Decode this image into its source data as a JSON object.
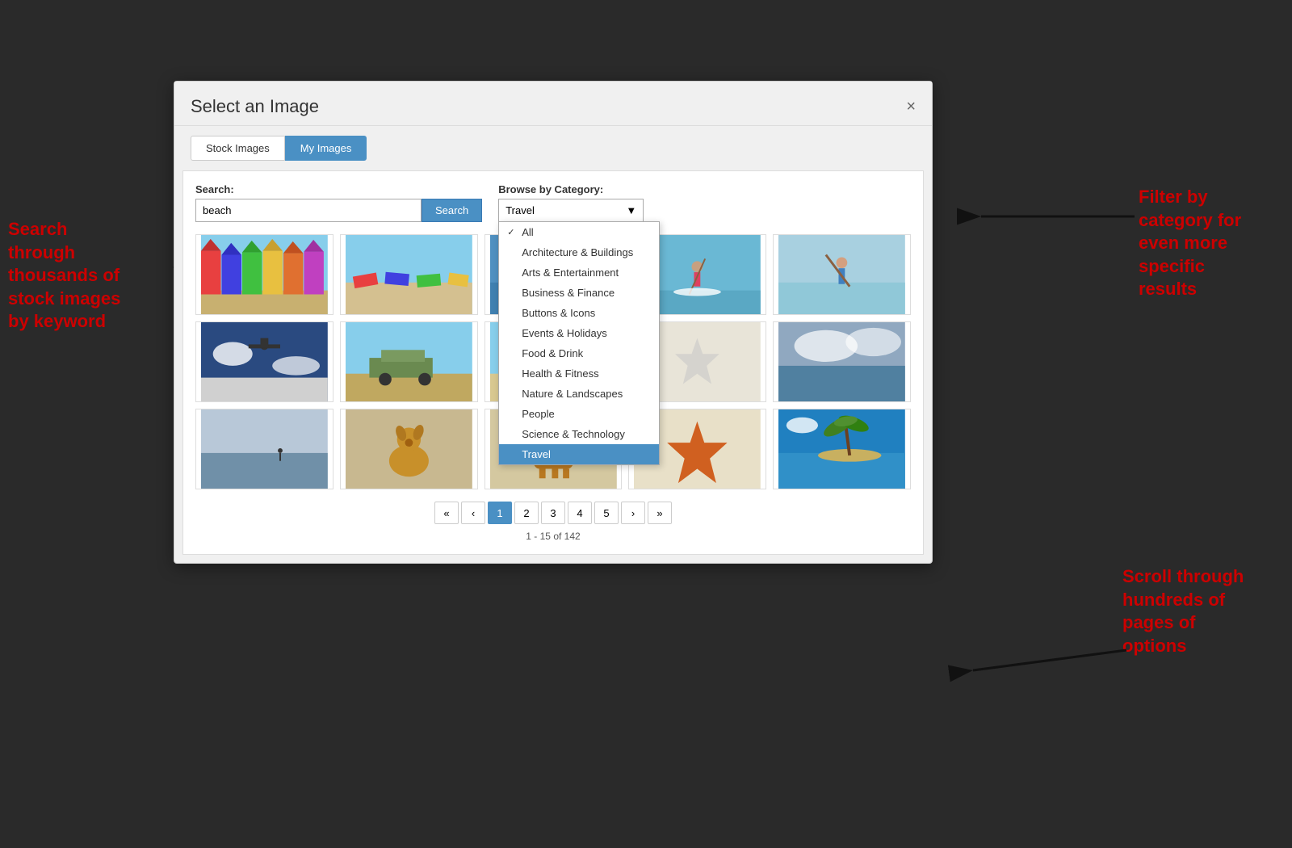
{
  "dialog": {
    "title": "Select an Image",
    "close_label": "×",
    "tabs": [
      {
        "id": "stock",
        "label": "Stock Images",
        "active": false
      },
      {
        "id": "my",
        "label": "My Images",
        "active": true
      }
    ],
    "search": {
      "label": "Search:",
      "placeholder": "beach",
      "value": "beach",
      "button_label": "Search"
    },
    "category": {
      "label": "Browse by Category:",
      "selected": "Travel",
      "options": [
        {
          "value": "all",
          "label": "All",
          "checked": true
        },
        {
          "value": "arch",
          "label": "Architecture & Buildings"
        },
        {
          "value": "arts",
          "label": "Arts & Entertainment"
        },
        {
          "value": "biz",
          "label": "Business & Finance"
        },
        {
          "value": "icons",
          "label": "Buttons & Icons"
        },
        {
          "value": "events",
          "label": "Events & Holidays"
        },
        {
          "value": "food",
          "label": "Food & Drink"
        },
        {
          "value": "health",
          "label": "Health & Fitness"
        },
        {
          "value": "nature",
          "label": "Nature & Landscapes"
        },
        {
          "value": "people",
          "label": "People"
        },
        {
          "value": "science",
          "label": "Science & Technology"
        },
        {
          "value": "travel",
          "label": "Travel",
          "active": true
        }
      ]
    },
    "pagination": {
      "pages": [
        "«",
        "‹",
        "1",
        "2",
        "3",
        "4",
        "5",
        "›",
        "»"
      ],
      "current": "1",
      "info": "1 - 15 of 142"
    }
  },
  "annotations": {
    "left": "Search\nthrough\nthousands of\nstock images\nby keyword",
    "right_top": "Filter by\ncategory for\neven more\nspecific\nresults",
    "right_bottom": "Scroll through\nhundreds of\npages of\noptions"
  }
}
